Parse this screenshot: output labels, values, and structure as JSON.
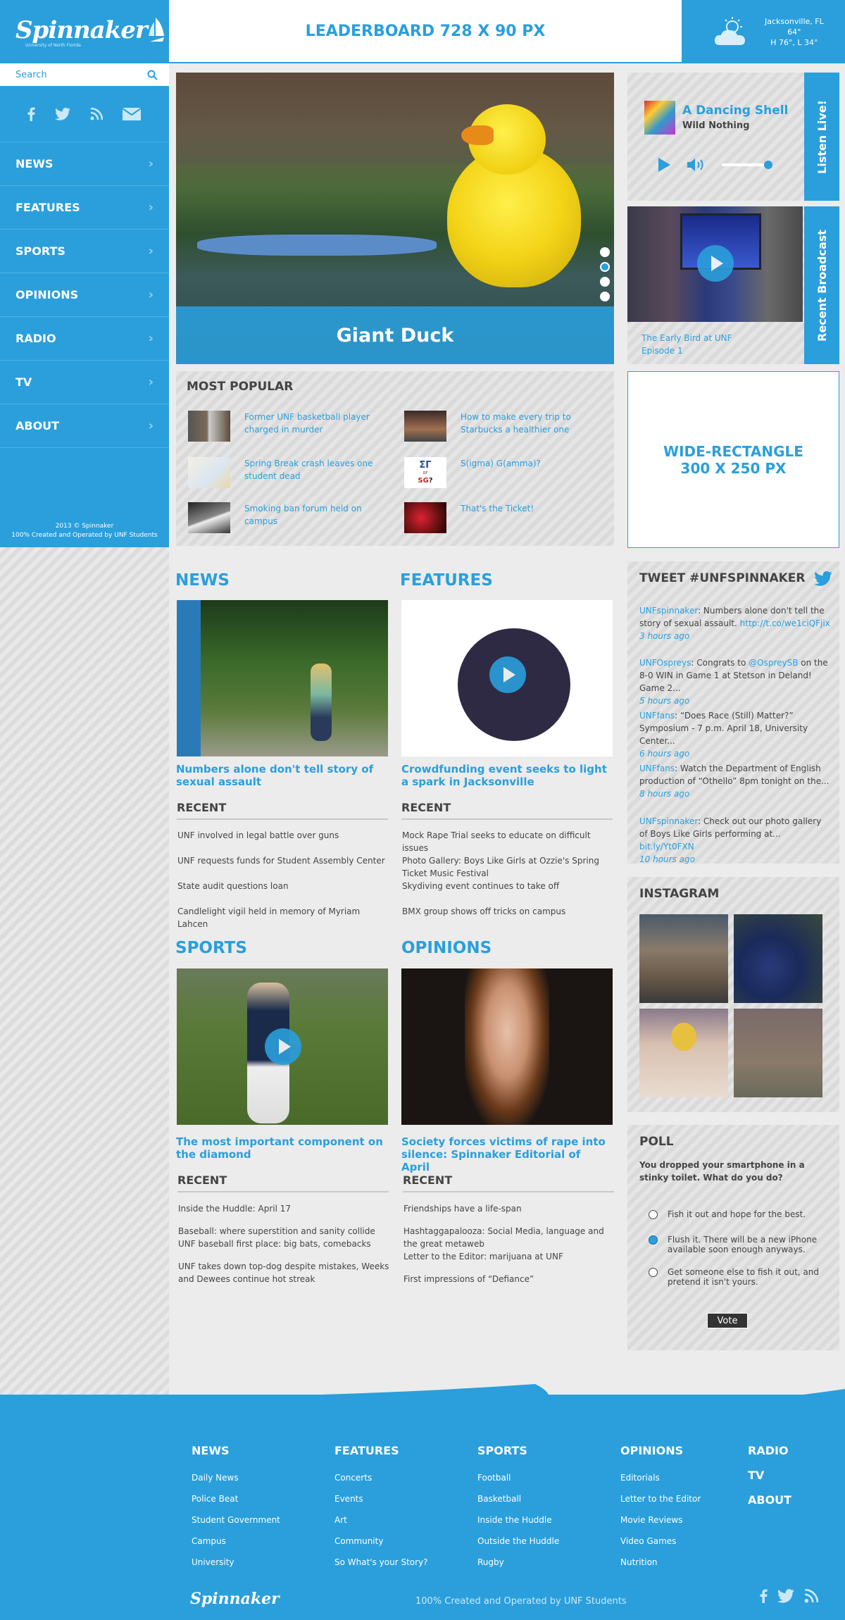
{
  "brand": {
    "logo": "Spinnaker",
    "tagline": "University of North Florida"
  },
  "search": {
    "placeholder": "Search"
  },
  "nav": [
    "NEWS",
    "FEATURES",
    "SPORTS",
    "OPINIONS",
    "RADIO",
    "TV",
    "ABOUT"
  ],
  "copyright": {
    "line1": "2013 © Spinnaker",
    "line2": "100% Created and Operated by UNF Students"
  },
  "leaderboard": "LEADERBOARD 728 X 90 PX",
  "weather": {
    "city": "Jacksonville, FL",
    "temp": "64°",
    "range": "H 76°, L 34°",
    "icon": "partly-cloudy-icon"
  },
  "hero": {
    "caption": "Giant Duck",
    "slides": 4,
    "active_slide": 2
  },
  "listen": {
    "tab": "Listen Live!",
    "song": "A Dancing Shell",
    "artist": "Wild Nothing",
    "volume": 0.9
  },
  "broadcast": {
    "tab": "Recent Broadcast",
    "title": "The Early Bird at UNF Episode 1"
  },
  "most_popular": {
    "title": "MOST POPULAR",
    "items": [
      "Former UNF basketball player charged in murder",
      "How to make every trip to Starbucks a healthier one",
      "Spring Break crash leaves one student dead",
      "S(igma) G(amma)?",
      "Smoking ban forum held on campus",
      "That's the Ticket!"
    ]
  },
  "wide_rect": {
    "line1": "WIDE-RECTANGLE",
    "line2": "300 X 250 PX"
  },
  "sections": {
    "news": {
      "title": "NEWS",
      "headline": "Numbers alone don't tell story of sexual assault",
      "recent_label": "RECENT",
      "recent": [
        "UNF involved in legal battle over guns",
        "UNF requests funds for Student Assembly Center",
        "State audit questions loan",
        "Candlelight vigil held in memory of Myriam Lahcen"
      ]
    },
    "features": {
      "title": "FEATURES",
      "headline": "Crowdfunding event seeks to light a spark in Jacksonville",
      "recent_label": "RECENT",
      "recent": [
        "Mock Rape Trial seeks to educate on difficult issues",
        "Photo Gallery: Boys Like Girls at Ozzie's Spring Ticket Music Festival",
        "Skydiving event continues to take off",
        "BMX group shows off tricks on campus"
      ]
    },
    "sports": {
      "title": "SPORTS",
      "headline": "The most important component on the diamond",
      "recent_label": "RECENT",
      "recent": [
        "Inside the Huddle: April 17",
        "Baseball: where superstition and sanity collide",
        "UNF baseball first place: big bats, comebacks",
        "UNF takes down top-dog despite mistakes, Weeks and Dewees continue hot streak"
      ]
    },
    "opinions": {
      "title": "OPINIONS",
      "headline": "Society forces victims of rape into silence: Spinnaker Editorial of April",
      "recent_label": "RECENT",
      "recent": [
        "Friendships have a life-span",
        "Hashtaggapalooza: Social Media, language and the great metaweb",
        "Letter to the Editor: marijuana at UNF",
        "First impressions of “Defiance”"
      ]
    }
  },
  "tweets": {
    "title": "TWEET #UNFSPINNAKER",
    "items": [
      {
        "user": "UNFspinnaker",
        "text": ": Numbers alone don't tell the story of sexual assault. ",
        "link": "http://t.co/we1ciQFjix",
        "time": "3 hours ago"
      },
      {
        "user": "UNFOspreys",
        "text": ": Congrats to ",
        "mention": "@OspreySB",
        "text2": " on the 8-0 WIN in Game 1 at Stetson in Deland! Game 2...",
        "time": "5 hours ago"
      },
      {
        "user": "UNFfans",
        "text": ": “Does Race (Still) Matter?” Symposium - 7 p.m. April 18, University Center...",
        "time": "6 hours ago"
      },
      {
        "user": "UNFfans",
        "text": ": Watch the Department of English production of “Othello” 8pm tonight on the...",
        "time": "8 hours ago"
      },
      {
        "user": "UNFspinnaker",
        "text": ": Check out our photo gallery of Boys Like Girls performing at... ",
        "link": "bit.ly/Yt0FXN",
        "time": "10 hours ago"
      }
    ]
  },
  "instagram": {
    "title": "INSTAGRAM"
  },
  "poll": {
    "title": "POLL",
    "question": "You dropped your smartphone in a stinky toilet. What do you do?",
    "options": [
      "Fish it out and hope for the best.",
      "Flush it. There will be a new iPhone available soon enough anyways.",
      "Get someone else to fish it out, and pretend it isn't yours."
    ],
    "selected": 1,
    "vote_label": "Vote"
  },
  "footer": {
    "columns": [
      {
        "title": "NEWS",
        "links": [
          "Daily News",
          "Police Beat",
          "Student Government",
          "Campus",
          "University"
        ]
      },
      {
        "title": "FEATURES",
        "links": [
          "Concerts",
          "Events",
          "Art",
          "Community",
          "So What's your Story?"
        ]
      },
      {
        "title": "SPORTS",
        "links": [
          "Football",
          "Basketball",
          "Inside the Huddle",
          "Outside the Huddle",
          "Rugby"
        ]
      },
      {
        "title": "OPINIONS",
        "links": [
          "Editorials",
          "Letter to the Editor",
          "Movie Reviews",
          "Video Games",
          "Nutrition"
        ]
      }
    ],
    "extra": [
      "RADIO",
      "TV",
      "ABOUT"
    ],
    "logo": "Spinnaker",
    "tagline": "100% Created and Operated by UNF Students"
  },
  "colors": {
    "accent": "#2a9fdc",
    "panel": "#dedede",
    "text": "#444444"
  }
}
